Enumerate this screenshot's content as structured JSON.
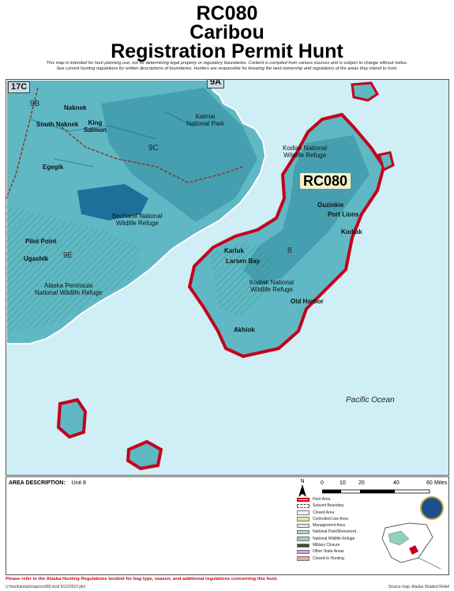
{
  "title": {
    "code": "RC080",
    "species": "Caribou",
    "hunt_type": "Registration Permit Hunt"
  },
  "disclaimer": {
    "line1": "This map is intended for hunt planning use, not for determining legal property or regulatory boundaries.  Content is compiled from various sources and is subject to change without notice.",
    "line2": "See current hunting regulations for written descriptions of boundaries.  Hunters are responsible for knowing the land ownership and regulations of the areas they intend to hunt."
  },
  "map": {
    "hunt_label": "RC080",
    "units": [
      "17C",
      "9B",
      "9A",
      "9C",
      "9E",
      "8"
    ],
    "places": {
      "naknek": "Naknek",
      "south_naknek": "South Naknek",
      "king_salmon_1": "King",
      "king_salmon_2": "Salmon",
      "katmai_1": "Katmai",
      "katmai_2": "National Park",
      "egegik": "Egegik",
      "becharof_1": "Becharof National",
      "becharof_2": "Wildlife Refuge",
      "pilot_point": "Pilot Point",
      "ugashik": "Ugashik",
      "ap_1": "Alaska Peninsula",
      "ap_2": "National Wildlife Refuge",
      "kodiak_nwr_n_1": "Kodiak National",
      "kodiak_nwr_n_2": "Wildlife Refuge",
      "ouzinkie": "Ouzinkie",
      "port_lions": "Port Lions",
      "kodiak": "Kodiak",
      "karluk": "Karluk",
      "larsen_bay": "Larsen Bay",
      "kodiak_nwr_s_1": "Kodiak National",
      "kodiak_nwr_s_2": "Wildlife Refuge",
      "old_harbor": "Old Harbor",
      "akhiok": "Akhiok"
    },
    "ocean": "Pacific Ocean",
    "colors": {
      "water": "#cfeef5",
      "land": "#5fb8c4",
      "land_dark": "#2f8aa0",
      "refuge_hatch": "#3aa38f",
      "hunt_boundary": "#c4001a",
      "subunit_boundary": "#8a3a2a"
    }
  },
  "area_description": {
    "label": "AREA DESCRIPTION:",
    "value": "Unit 8"
  },
  "scale": {
    "ticks": [
      "0",
      "10",
      "20",
      "40",
      "60"
    ],
    "unit": "Miles"
  },
  "north_label": "N",
  "legend": [
    {
      "label": "Hunt Area",
      "color": "#c4001a",
      "icon": "hunt-area-swatch"
    },
    {
      "label": "Subunit Boundary",
      "color": "#8a3a2a",
      "icon": "subunit-boundary-swatch"
    },
    {
      "label": "Closed Area",
      "color": "#f2f2f2",
      "icon": "closed-area-swatch"
    },
    {
      "label": "Controlled Use Area",
      "color": "#e8e0a0",
      "icon": "controlled-use-swatch"
    },
    {
      "label": "Management Area",
      "color": "#d8ecf4",
      "icon": "management-area-swatch"
    },
    {
      "label": "National Park/Monument",
      "color": "#b8dca0",
      "icon": "national-park-swatch"
    },
    {
      "label": "National Wildlife Refuge",
      "color": "#9fd0c4",
      "icon": "wildlife-refuge-swatch"
    },
    {
      "label": "Military Closure",
      "color": "#444444",
      "icon": "military-closure-swatch"
    },
    {
      "label": "Other State Areas",
      "color": "#c8a8d8",
      "icon": "state-areas-swatch"
    },
    {
      "label": "Closed to Hunting",
      "color": "#f0a8a8",
      "icon": "closed-hunting-swatch"
    }
  ],
  "footer": {
    "regs": "Please refer to the Alaska Hunting Regulations booklet for bag type, season, and additional regulations concerning this hunt.",
    "path": "U:\\hunt\\areas\\maps\\rc080.mxd  6/12/2023  jdm",
    "source": "Source map:  Alaska Shaded Relief"
  }
}
